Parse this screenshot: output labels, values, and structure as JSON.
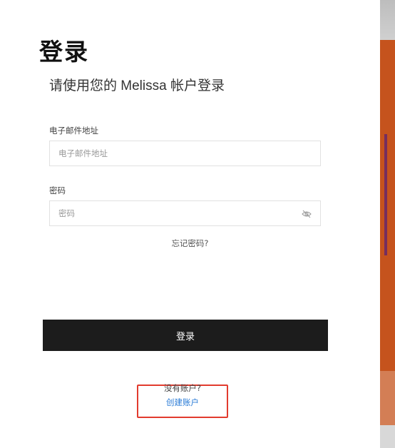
{
  "page": {
    "title": "登录",
    "subtitle": "请使用您的 Melissa 帐户登录"
  },
  "form": {
    "email_label": "电子邮件地址",
    "email_placeholder": "电子邮件地址",
    "email_value": "",
    "password_label": "密码",
    "password_placeholder": "密码",
    "password_value": "",
    "forgot_link": "忘记密码?",
    "submit_label": "登录"
  },
  "signup": {
    "prompt": "没有账户?",
    "link": "创建账户"
  },
  "icons": {
    "password_toggle": "eye-slash-icon"
  },
  "colors": {
    "button_bg": "#1c1c1c",
    "link": "#2a7bd6",
    "highlight_box": "#e23b2e",
    "side_background": "#c5531d"
  }
}
